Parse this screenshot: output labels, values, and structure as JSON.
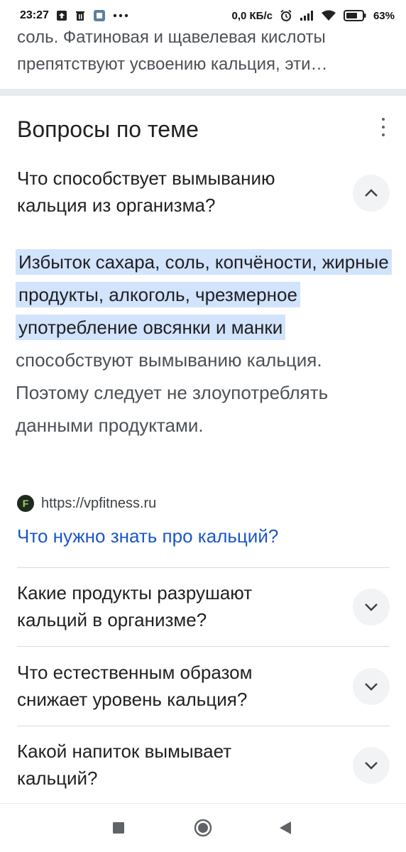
{
  "status_bar": {
    "time": "23:27",
    "speed": "0,0 КБ/с",
    "battery": "63%",
    "icons": [
      "upload-icon",
      "trash-icon",
      "app-icon",
      "more-notifications-icon",
      "alarm-icon",
      "signal-icon",
      "wifi-icon",
      "battery-icon"
    ]
  },
  "prev_snippet": {
    "line1": "соль. Фатиновая и щавелевая кислоты",
    "line2": "препятствуют усвоению кальция, эти…"
  },
  "section": {
    "title": "Вопросы по теме"
  },
  "expanded_question": {
    "line1": "Что способствует вымыванию",
    "line2": "кальция из организма?"
  },
  "answer": {
    "highlighted": "Избыток сахара, соль, копчёности, жирные продукты, алкоголь, чрезмерное употребление овсянки и манки",
    "rest": " способствуют вымыванию кальция. Поэтому следует не злоупотреблять данными продуктами."
  },
  "source": {
    "url": "https://vpfitness.ru",
    "favicon_letter": "F"
  },
  "more_link": "Что нужно знать про кальций?",
  "questions": [
    {
      "line1": "Какие продукты разрушают",
      "line2": "кальций в организме?"
    },
    {
      "line1": "Что естественным образом",
      "line2": "снижает уровень кальция?"
    },
    {
      "line1": "Какой напиток вымывает",
      "line2": "кальций?"
    }
  ],
  "colors": {
    "highlight": "#d2e3fc",
    "link": "#1a57c8"
  }
}
